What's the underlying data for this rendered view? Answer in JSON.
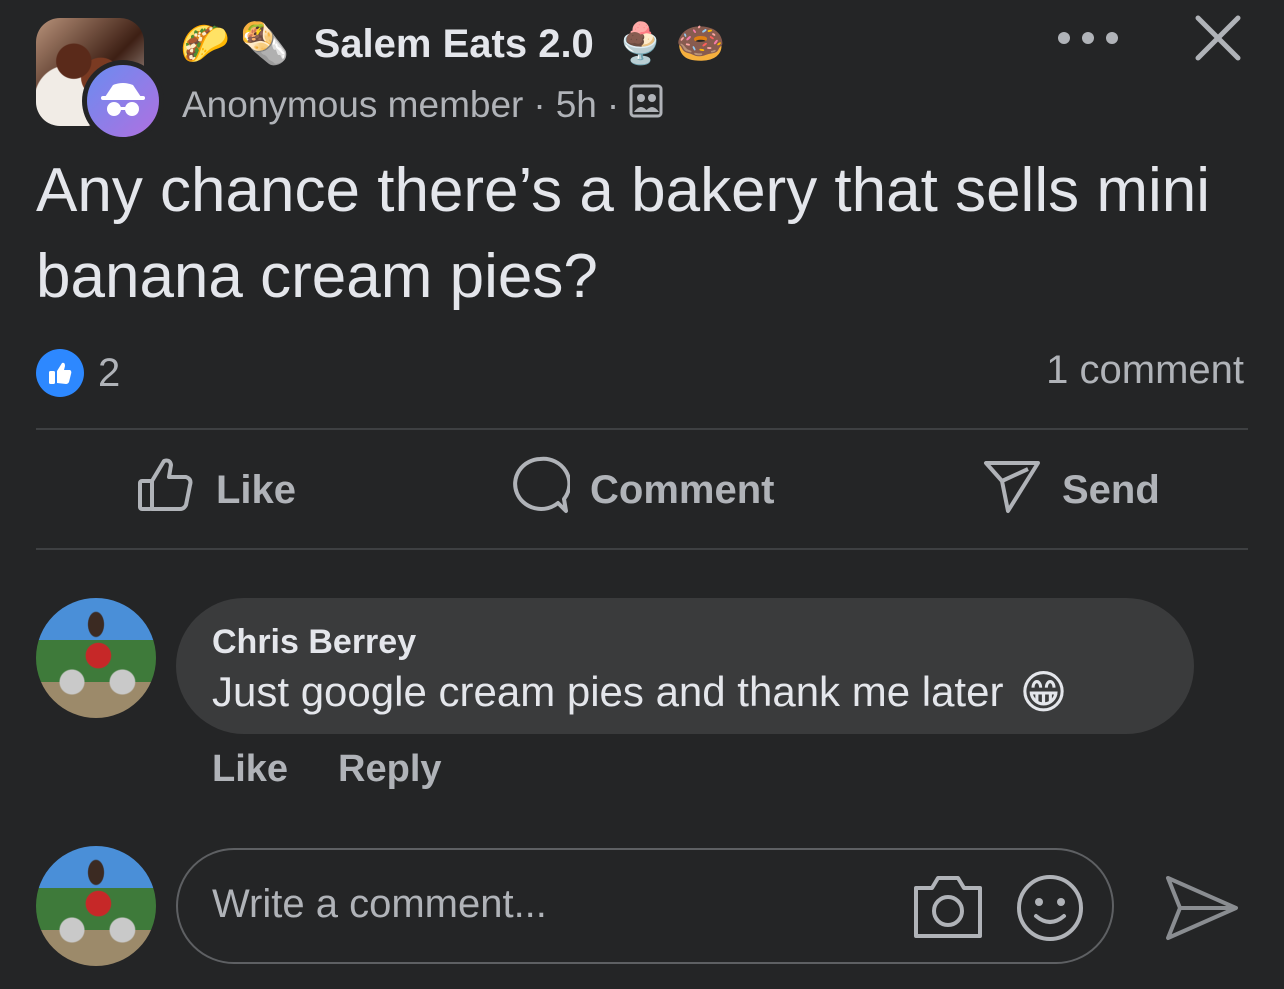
{
  "header": {
    "group_name": "Salem Eats 2.0",
    "leading_emoji": [
      "🌮",
      "🌯"
    ],
    "trailing_emoji": [
      "🍨",
      "🍩"
    ],
    "author": "Anonymous member",
    "separator": "·",
    "time": "5h",
    "privacy_icon": "group-members-icon",
    "more_icon": "more-options-icon",
    "close_icon": "close-icon"
  },
  "post": {
    "text": "Any chance there’s a bakery that sells mini banana cream pies?",
    "reaction_count": "2",
    "comment_count": "1 comment"
  },
  "actions": {
    "like": "Like",
    "comment": "Comment",
    "send": "Send"
  },
  "comment": {
    "author": "Chris Berrey",
    "text": "Just google cream pies and thank me later",
    "emoji": "😁",
    "like": "Like",
    "reply": "Reply"
  },
  "composer": {
    "placeholder": "Write a comment..."
  },
  "colors": {
    "background": "#242526",
    "bubble": "#3a3b3c",
    "primary_text": "#e4e6eb",
    "secondary_text": "#b0b3b8",
    "like_blue": "#2d88ff"
  }
}
